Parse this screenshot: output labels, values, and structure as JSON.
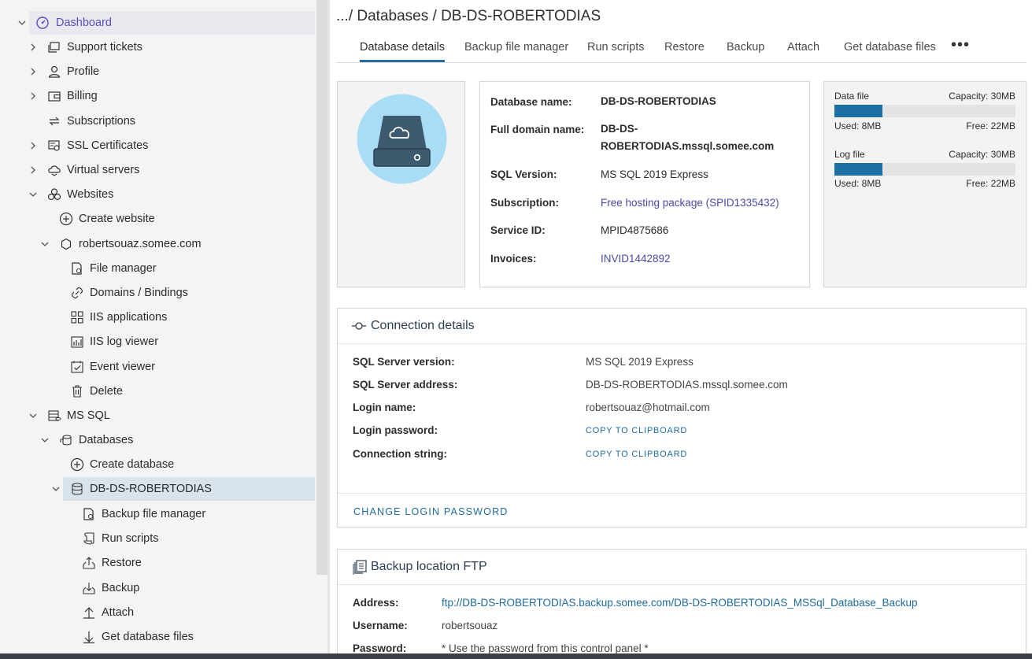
{
  "sidebar": {
    "items": [
      {
        "label": "Dashboard"
      },
      {
        "label": "Support tickets"
      },
      {
        "label": "Profile"
      },
      {
        "label": "Billing"
      },
      {
        "label": "Subscriptions"
      },
      {
        "label": "SSL Certificates"
      },
      {
        "label": "Virtual servers"
      },
      {
        "label": "Websites"
      },
      {
        "label": "Create website"
      },
      {
        "label": "robertsouaz.somee.com"
      },
      {
        "label": "File manager"
      },
      {
        "label": "Domains / Bindings"
      },
      {
        "label": "IIS applications"
      },
      {
        "label": "IIS log viewer"
      },
      {
        "label": "Event viewer"
      },
      {
        "label": "Delete"
      },
      {
        "label": "MS SQL"
      },
      {
        "label": "Databases"
      },
      {
        "label": "Create database"
      },
      {
        "label": "DB-DS-ROBERTODIAS"
      },
      {
        "label": "Backup file manager"
      },
      {
        "label": "Run scripts"
      },
      {
        "label": "Restore"
      },
      {
        "label": "Backup"
      },
      {
        "label": "Attach"
      },
      {
        "label": "Get database files"
      }
    ]
  },
  "header": {
    "breadcrumb": ".../ Databases / DB-DS-ROBERTODIAS"
  },
  "tabs": [
    {
      "label": "Database details"
    },
    {
      "label": "Backup file manager"
    },
    {
      "label": "Run scripts"
    },
    {
      "label": "Restore"
    },
    {
      "label": "Backup"
    },
    {
      "label": "Attach"
    },
    {
      "label": "Get database files"
    }
  ],
  "tab_more": "•••",
  "details": {
    "db_name_label": "Database name:",
    "db_name": "DB-DS-ROBERTODIAS",
    "fqdn_label": "Full domain name:",
    "fqdn_line1": "DB-DS-",
    "fqdn_line2": "ROBERTODIAS.mssql.somee.com",
    "sql_version_label": "SQL Version:",
    "sql_version": "MS SQL 2019 Express",
    "subscription_label": "Subscription:",
    "subscription": "Free hosting package (SPID1335432)",
    "service_id_label": "Service ID:",
    "service_id": "MPID4875686",
    "invoices_label": "Invoices:",
    "invoices": "INVID1442892"
  },
  "usage": {
    "data": {
      "title": "Data file",
      "capacity": "Capacity: 30MB",
      "used": "Used: 8MB",
      "free": "Free: 22MB",
      "fraction": 0.2667
    },
    "log": {
      "title": "Log file",
      "capacity": "Capacity: 30MB",
      "used": "Used: 8MB",
      "free": "Free: 22MB",
      "fraction": 0.2667
    }
  },
  "connection": {
    "title": "Connection details",
    "server_version_label": "SQL Server version:",
    "server_version": "MS SQL 2019 Express",
    "server_address_label": "SQL Server address:",
    "server_address": "DB-DS-ROBERTODIAS.mssql.somee.com",
    "login_name_label": "Login name:",
    "login_name": "robertsouaz@hotmail.com",
    "login_password_label": "Login password:",
    "connection_string_label": "Connection string:",
    "copy_label": "COPY TO CLIPBOARD",
    "change_password": "CHANGE LOGIN PASSWORD"
  },
  "ftp": {
    "title": "Backup location FTP",
    "address_label": "Address:",
    "address": "ftp://DB-DS-ROBERTODIAS.backup.somee.com/DB-DS-ROBERTODIAS_MSSql_Database_Backup",
    "username_label": "Username:",
    "username": "robertsouaz",
    "password_label": "Password:",
    "password_note": "* Use the password from this control panel *"
  },
  "colors": {
    "accent": "#1d70a3",
    "link": "#4a4aa8",
    "active_nav": "#5a4fbf",
    "selected_row": "#d9e3ec",
    "db_icon_bg": "#a9dcf5",
    "db_icon_body": "#3e5a6e"
  }
}
